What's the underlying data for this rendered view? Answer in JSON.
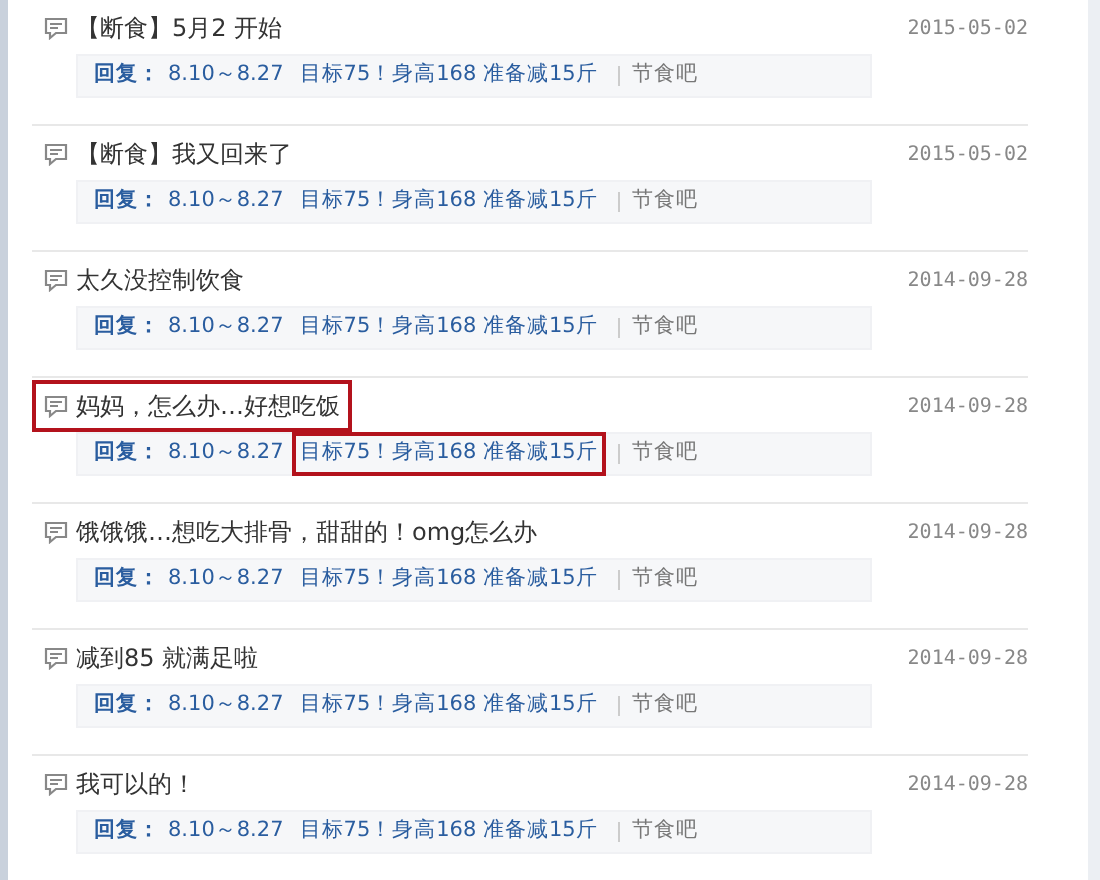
{
  "posts": [
    {
      "title": "【断食】5月2 开始",
      "highlighted": false,
      "date": "2015-05-02",
      "reply": {
        "label": "回复：",
        "segments": [
          {
            "text": "8.10～8.27",
            "highlighted": false
          },
          {
            "text": "目标75！身高168 准备减15斤",
            "highlighted": false
          }
        ]
      },
      "forum": "节食吧"
    },
    {
      "title": "【断食】我又回来了",
      "highlighted": false,
      "date": "2015-05-02",
      "reply": {
        "label": "回复：",
        "segments": [
          {
            "text": "8.10～8.27",
            "highlighted": false
          },
          {
            "text": "目标75！身高168 准备减15斤",
            "highlighted": false
          }
        ]
      },
      "forum": "节食吧"
    },
    {
      "title": "太久没控制饮食",
      "highlighted": false,
      "date": "2014-09-28",
      "reply": {
        "label": "回复：",
        "segments": [
          {
            "text": "8.10～8.27",
            "highlighted": false
          },
          {
            "text": "目标75！身高168 准备减15斤",
            "highlighted": false
          }
        ]
      },
      "forum": "节食吧"
    },
    {
      "title": "妈妈，怎么办…好想吃饭",
      "highlighted": true,
      "date": "2014-09-28",
      "reply": {
        "label": "回复：",
        "segments": [
          {
            "text": "8.10～8.27",
            "highlighted": false
          },
          {
            "text": "目标75！身高168 准备减15斤",
            "highlighted": true
          }
        ]
      },
      "forum": "节食吧"
    },
    {
      "title": "饿饿饿…想吃大排骨，甜甜的！omg怎么办",
      "highlighted": false,
      "date": "2014-09-28",
      "reply": {
        "label": "回复：",
        "segments": [
          {
            "text": "8.10～8.27",
            "highlighted": false
          },
          {
            "text": "目标75！身高168 准备减15斤",
            "highlighted": false
          }
        ]
      },
      "forum": "节食吧"
    },
    {
      "title": "减到85 就满足啦",
      "highlighted": false,
      "date": "2014-09-28",
      "reply": {
        "label": "回复：",
        "segments": [
          {
            "text": "8.10～8.27",
            "highlighted": false
          },
          {
            "text": "目标75！身高168 准备减15斤",
            "highlighted": false
          }
        ]
      },
      "forum": "节食吧"
    },
    {
      "title": "我可以的！",
      "highlighted": false,
      "date": "2014-09-28",
      "reply": {
        "label": "回复：",
        "segments": [
          {
            "text": "8.10～8.27",
            "highlighted": false
          },
          {
            "text": "目标75！身高168 准备减15斤",
            "highlighted": false
          }
        ]
      },
      "forum": "节食吧"
    }
  ]
}
